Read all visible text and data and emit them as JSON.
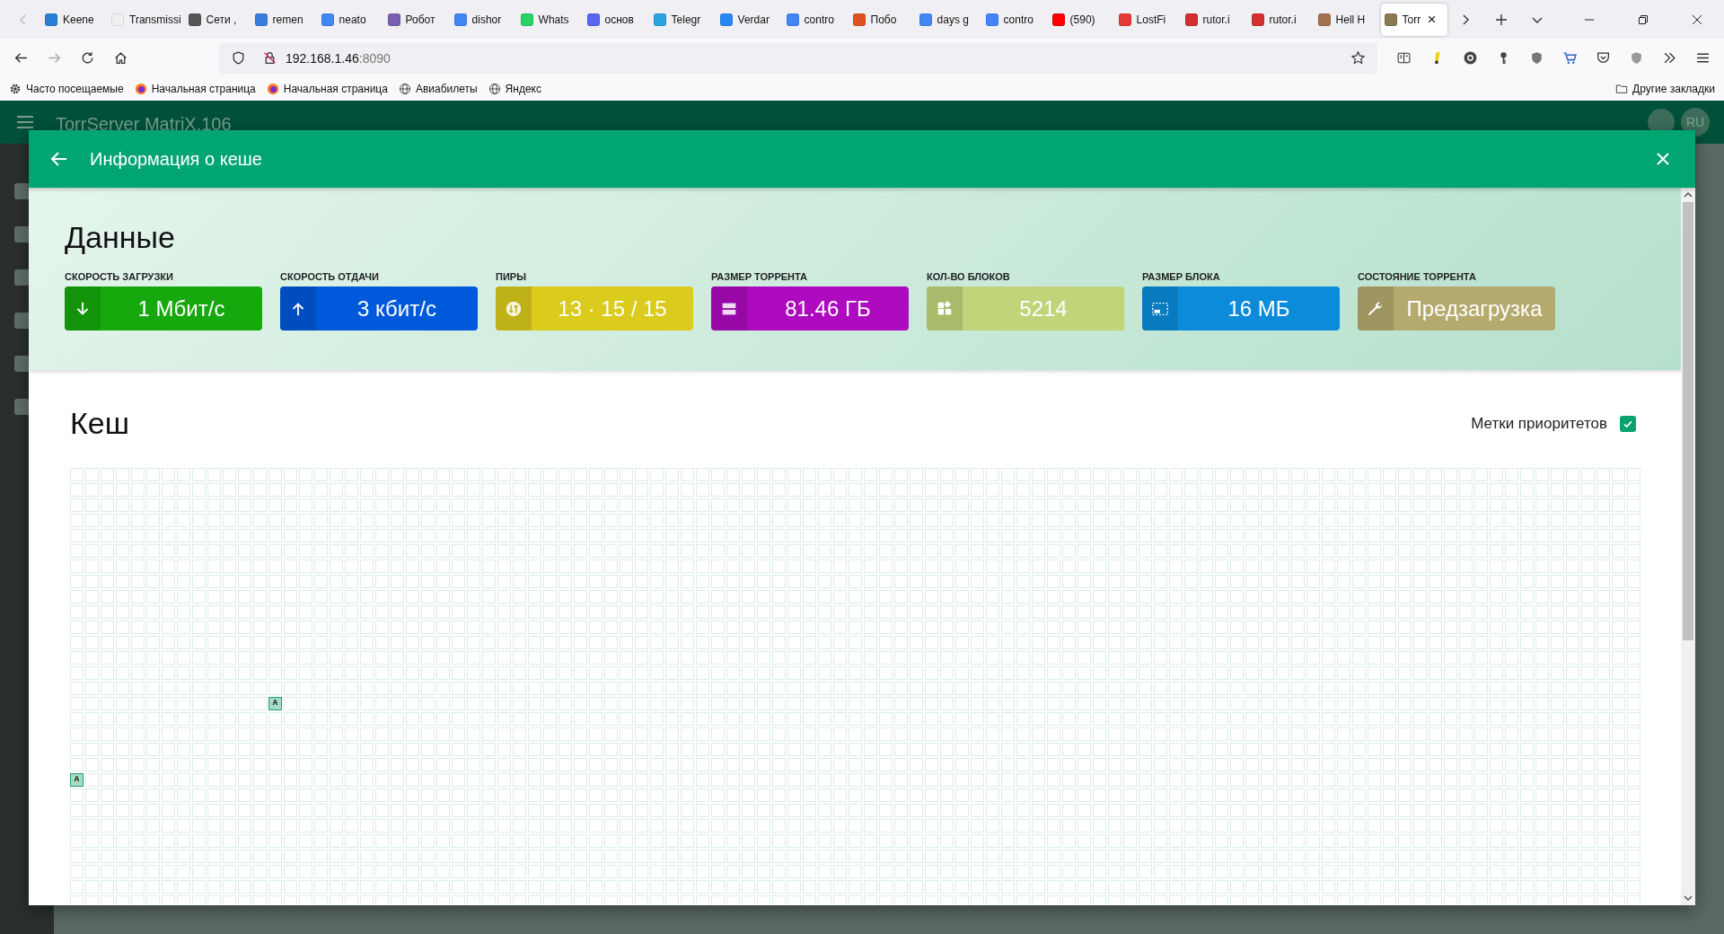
{
  "browser": {
    "tabs": [
      {
        "label": "Keene",
        "color": "#2a7fd4",
        "selected": false
      },
      {
        "label": "Transmissi",
        "color": "#f0f0f0",
        "selected": false
      },
      {
        "label": "Сети ,",
        "color": "#555555",
        "selected": false
      },
      {
        "label": "remen",
        "color": "#3a7be0",
        "selected": false
      },
      {
        "label": "neato",
        "color": "#4285f4",
        "selected": false
      },
      {
        "label": "Робот",
        "color": "#7a5fb0",
        "selected": false
      },
      {
        "label": "dishor",
        "color": "#4285f4",
        "selected": false
      },
      {
        "label": "Whats",
        "color": "#25d366",
        "selected": false
      },
      {
        "label": "основ",
        "color": "#5865f2",
        "selected": false
      },
      {
        "label": "Telegr",
        "color": "#2aa3e0",
        "selected": false
      },
      {
        "label": "Verdar",
        "color": "#2787f5",
        "selected": false
      },
      {
        "label": "contro",
        "color": "#4285f4",
        "selected": false
      },
      {
        "label": "Побо",
        "color": "#e05020",
        "selected": false
      },
      {
        "label": "days g",
        "color": "#4285f4",
        "selected": false
      },
      {
        "label": "contro",
        "color": "#4285f4",
        "selected": false
      },
      {
        "label": "(590) ",
        "color": "#ff0000",
        "selected": false
      },
      {
        "label": "LostFi",
        "color": "#e53935",
        "selected": false
      },
      {
        "label": "rutor.i",
        "color": "#d32f2f",
        "selected": false
      },
      {
        "label": "rutor.i",
        "color": "#d32f2f",
        "selected": false
      },
      {
        "label": "Hell H",
        "color": "#a07050",
        "selected": false
      },
      {
        "label": "Torr",
        "color": "#8a7a50",
        "selected": true
      }
    ],
    "address": {
      "host": "192.168.1.46",
      "port": ":8090"
    },
    "bookmarks": [
      {
        "label": "Часто посещаемые",
        "kind": "gear"
      },
      {
        "label": "Начальная страница",
        "kind": "firefox"
      },
      {
        "label": "Начальная страница",
        "kind": "firefox"
      },
      {
        "label": "Авиабилеты",
        "kind": "globe"
      },
      {
        "label": "Яндекс",
        "kind": "globe"
      }
    ],
    "other_bookmarks": "Другие закладки"
  },
  "app": {
    "title": "TorrServer MatriX.106",
    "language": "RU"
  },
  "dialog": {
    "title": "Информация о кеше",
    "data": {
      "title": "Данные",
      "stats": [
        {
          "kind": "download",
          "label": "СКОРОСТЬ ЗАГРУЗКИ",
          "value": "1 Мбит/с",
          "color": "#16a80c"
        },
        {
          "kind": "upload",
          "label": "СКОРОСТЬ ОТДАЧИ",
          "value": "3 кбит/с",
          "color": "#0058db"
        },
        {
          "kind": "peers",
          "label": "ПИРЫ",
          "value": "13 · 15 / 15",
          "color": "#dacb1c"
        },
        {
          "kind": "size",
          "label": "РАЗМЕР ТОРРЕНТА",
          "value": "81.46 ГБ",
          "color": "#ae0abf"
        },
        {
          "kind": "blocks",
          "label": "КОЛ-ВО БЛОКОВ",
          "value": "5214",
          "color": "#c2d47a"
        },
        {
          "kind": "block_size",
          "label": "РАЗМЕР БЛОКА",
          "value": "16 МБ",
          "color": "#0b8bd9"
        },
        {
          "kind": "state",
          "label": "СОСТОЯНИЕ ТОРРЕНТА",
          "value": "Предзагрузка",
          "color": "#b5aa6e"
        }
      ]
    },
    "cache": {
      "title": "Кеш",
      "priority_marks": {
        "label": "Метки приоритетов",
        "checked": true
      },
      "marked_blocks": [
        {
          "label": "A"
        },
        {
          "label": "A"
        }
      ]
    }
  }
}
